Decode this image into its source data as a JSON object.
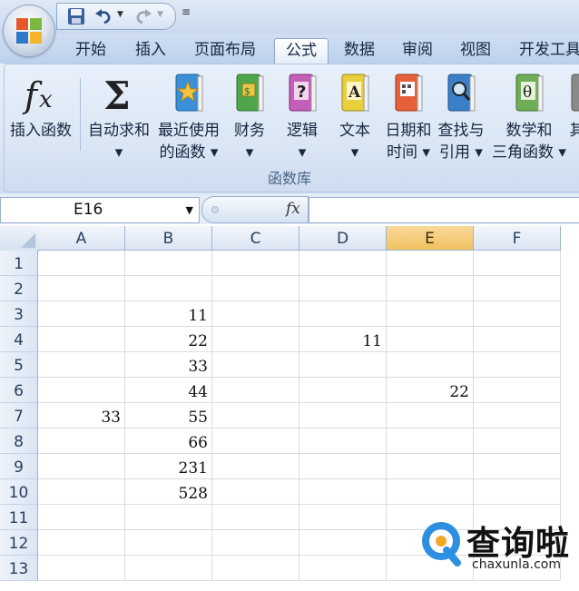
{
  "tabs": [
    "开始",
    "插入",
    "页面布局",
    "公式",
    "数据",
    "审阅",
    "视图",
    "开发工具"
  ],
  "active_tab": "公式",
  "ribbon": {
    "buttons": [
      {
        "line1": "插入函数",
        "line2": ""
      },
      {
        "line1": "自动求和",
        "line2": "▾"
      },
      {
        "line1": "最近使用",
        "line2": "的函数 ▾"
      },
      {
        "line1": "财务",
        "line2": "▾"
      },
      {
        "line1": "逻辑",
        "line2": "▾"
      },
      {
        "line1": "文本",
        "line2": "▾"
      },
      {
        "line1": "日期和",
        "line2": "时间 ▾"
      },
      {
        "line1": "查找与",
        "line2": "引用 ▾"
      },
      {
        "line1": "数学和",
        "line2": "三角函数 ▾"
      },
      {
        "line1": "其",
        "line2": ""
      }
    ],
    "group_label": "函数库"
  },
  "formula_bar": {
    "name_box": "E16",
    "fx_label": "fx"
  },
  "grid": {
    "columns": [
      "A",
      "B",
      "C",
      "D",
      "E",
      "F"
    ],
    "selected_column": "E",
    "rows": [
      "1",
      "2",
      "3",
      "4",
      "5",
      "6",
      "7",
      "8",
      "9",
      "10",
      "11",
      "12",
      "13"
    ],
    "cells": [
      {
        "col": "B",
        "row": 3,
        "value": "11"
      },
      {
        "col": "B",
        "row": 4,
        "value": "22"
      },
      {
        "col": "D",
        "row": 4,
        "value": "11"
      },
      {
        "col": "B",
        "row": 5,
        "value": "33"
      },
      {
        "col": "B",
        "row": 6,
        "value": "44"
      },
      {
        "col": "E",
        "row": 6,
        "value": "22"
      },
      {
        "col": "A",
        "row": 7,
        "value": "33"
      },
      {
        "col": "B",
        "row": 7,
        "value": "55"
      },
      {
        "col": "B",
        "row": 8,
        "value": "66"
      },
      {
        "col": "B",
        "row": 9,
        "value": "231"
      },
      {
        "col": "B",
        "row": 10,
        "value": "528"
      }
    ]
  },
  "watermark": {
    "brand_cn": "查询啦",
    "brand_en": "chaxunla.com"
  }
}
